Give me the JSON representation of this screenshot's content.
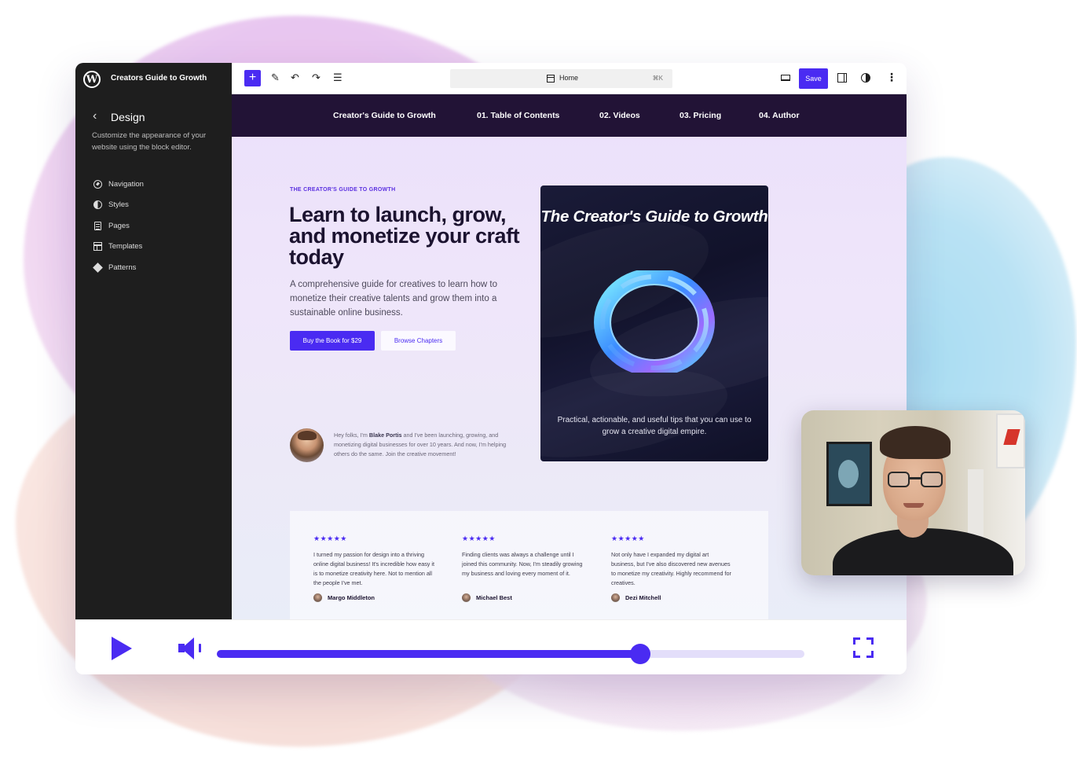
{
  "editor": {
    "site_name": "Creators Guide to Growth",
    "panel_title": "Design",
    "panel_description": "Customize the appearance of your website using the block editor.",
    "nav_items": [
      {
        "label": "Navigation",
        "icon": "navigation-icon"
      },
      {
        "label": "Styles",
        "icon": "styles-icon"
      },
      {
        "label": "Pages",
        "icon": "page-icon"
      },
      {
        "label": "Templates",
        "icon": "template-icon"
      },
      {
        "label": "Patterns",
        "icon": "patterns-icon"
      }
    ]
  },
  "toolbar": {
    "add_label": "+",
    "page_label": "Home",
    "shortcut": "⌘K",
    "save_label": "Save",
    "more_label": "⋮",
    "accent_color": "#4a2bf2"
  },
  "site": {
    "nav": [
      "Creator's Guide to Growth",
      "01. Table of Contents",
      "02. Videos",
      "03. Pricing",
      "04. Author"
    ],
    "eyebrow": "THE CREATOR'S GUIDE TO GROWTH",
    "headline": "Learn to launch, grow, and monetize your craft today",
    "lead": "A comprehensive guide for creatives to learn how to monetize their creative talents and grow them into a sustainable online business.",
    "primary_cta": "Buy the Book for $29",
    "secondary_cta": "Browse Chapters",
    "author_bio_prefix": "Hey folks, I'm ",
    "author_name": "Blake Portis",
    "author_bio_suffix": " and I've been launching, growing, and monetizing digital businesses for over 10 years. And now, I'm helping others do the same. Join the creative movement!",
    "book_title": "The Creator's Guide to Growth",
    "book_tagline": "Practical, actionable, and useful tips that you can use to grow a creative digital empire."
  },
  "reviews": [
    {
      "stars": "★★★★★",
      "text": "I turned my passion for design into a thriving online digital business! It's incredible how easy it is to monetize creativity here. Not to mention all the people I've met.",
      "name": "Margo Middleton"
    },
    {
      "stars": "★★★★★",
      "text": "Finding clients was always a challenge until I joined this community. Now, I'm steadily growing my business and loving every moment of it.",
      "name": "Michael Best"
    },
    {
      "stars": "★★★★★",
      "text": "Not only have I expanded my digital art business, but I've also discovered new avenues to monetize my creativity. Highly recommend for creatives.",
      "name": "Dezi Mitchell"
    }
  ],
  "player": {
    "progress": 0.72
  }
}
